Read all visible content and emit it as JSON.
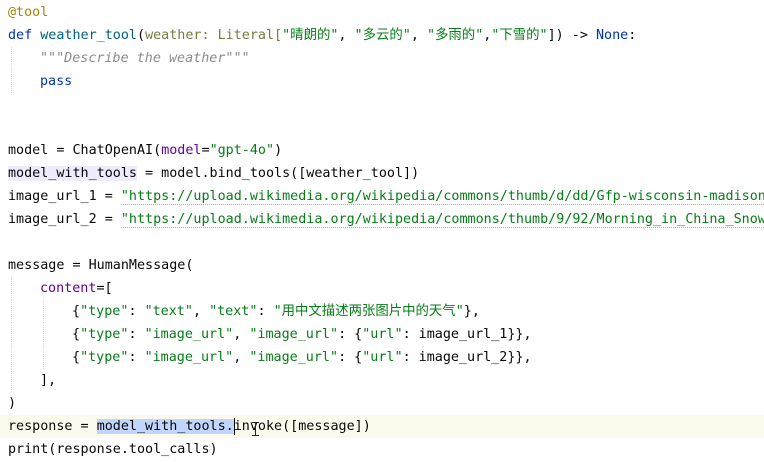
{
  "editor": {
    "lines": [
      {
        "indent": 0,
        "tokens": [
          {
            "t": "@tool",
            "c": "deco"
          }
        ]
      },
      {
        "indent": 0,
        "tokens": [
          {
            "t": "def ",
            "c": "kw"
          },
          {
            "t": "weather_tool",
            "c": "fn"
          },
          {
            "t": "(",
            "c": "plain"
          },
          {
            "t": "weather",
            "c": "param"
          },
          {
            "t": ": Literal[",
            "c": "param"
          },
          {
            "t": "\"晴朗的\"",
            "c": "str"
          },
          {
            "t": ", ",
            "c": "plain"
          },
          {
            "t": "\"多云的\"",
            "c": "str"
          },
          {
            "t": ", ",
            "c": "plain"
          },
          {
            "t": "\"多雨的\"",
            "c": "str"
          },
          {
            "t": ",",
            "c": "plain"
          },
          {
            "t": "\"下雪的\"",
            "c": "str"
          },
          {
            "t": "]) -> ",
            "c": "plain"
          },
          {
            "t": "None",
            "c": "kw"
          },
          {
            "t": ":",
            "c": "plain"
          }
        ]
      },
      {
        "indent": 1,
        "tokens": [
          {
            "t": "\"\"\"Describe the weather\"\"\"",
            "c": "doc"
          }
        ]
      },
      {
        "indent": 1,
        "tokens": [
          {
            "t": "pass",
            "c": "kw"
          }
        ]
      },
      {
        "indent": 0,
        "tokens": []
      },
      {
        "indent": 0,
        "tokens": []
      },
      {
        "indent": 0,
        "tokens": [
          {
            "t": "model = ChatOpenAI(",
            "c": "plain"
          },
          {
            "t": "model",
            "c": "kwarg"
          },
          {
            "t": "=",
            "c": "plain"
          },
          {
            "t": "\"gpt-4o\"",
            "c": "str"
          },
          {
            "t": ")",
            "c": "plain"
          }
        ]
      },
      {
        "indent": 0,
        "tokens": [
          {
            "t": "model_with_tools",
            "c": "plain usage"
          },
          {
            "t": " = model.bind_tools([weather_tool])",
            "c": "plain"
          }
        ]
      },
      {
        "indent": 0,
        "tokens": [
          {
            "t": "image_url_1 = ",
            "c": "plain"
          },
          {
            "t": "\"https://upload.wikimedia.org/wikipedia/commons/thumb/d/dd/Gfp-wisconsin-madison-th",
            "c": "str warn"
          }
        ]
      },
      {
        "indent": 0,
        "tokens": [
          {
            "t": "image_url_2 = ",
            "c": "plain"
          },
          {
            "t": "\"https://upload.wikimedia.org/wikipedia/commons/thumb/9/92/Morning_in_China_Snow_To",
            "c": "str warn"
          }
        ]
      },
      {
        "indent": 0,
        "tokens": []
      },
      {
        "indent": 0,
        "tokens": [
          {
            "t": "message = HumanMessage(",
            "c": "plain"
          }
        ]
      },
      {
        "indent": 1,
        "tokens": [
          {
            "t": "content",
            "c": "kwarg"
          },
          {
            "t": "=[",
            "c": "plain"
          }
        ]
      },
      {
        "indent": 2,
        "tokens": [
          {
            "t": "{",
            "c": "plain"
          },
          {
            "t": "\"type\"",
            "c": "str"
          },
          {
            "t": ": ",
            "c": "plain"
          },
          {
            "t": "\"text\"",
            "c": "str"
          },
          {
            "t": ", ",
            "c": "plain"
          },
          {
            "t": "\"text\"",
            "c": "str"
          },
          {
            "t": ": ",
            "c": "plain"
          },
          {
            "t": "\"用中文描述两张图片中的天气\"",
            "c": "str"
          },
          {
            "t": "},",
            "c": "plain"
          }
        ]
      },
      {
        "indent": 2,
        "tokens": [
          {
            "t": "{",
            "c": "plain"
          },
          {
            "t": "\"type\"",
            "c": "str"
          },
          {
            "t": ": ",
            "c": "plain"
          },
          {
            "t": "\"image_url\"",
            "c": "str"
          },
          {
            "t": ", ",
            "c": "plain"
          },
          {
            "t": "\"image_url\"",
            "c": "str"
          },
          {
            "t": ": {",
            "c": "plain"
          },
          {
            "t": "\"url\"",
            "c": "str"
          },
          {
            "t": ": image_url_1}},",
            "c": "plain"
          }
        ]
      },
      {
        "indent": 2,
        "tokens": [
          {
            "t": "{",
            "c": "plain"
          },
          {
            "t": "\"type\"",
            "c": "str"
          },
          {
            "t": ": ",
            "c": "plain"
          },
          {
            "t": "\"image_url\"",
            "c": "str"
          },
          {
            "t": ", ",
            "c": "plain"
          },
          {
            "t": "\"image_url\"",
            "c": "str"
          },
          {
            "t": ": {",
            "c": "plain"
          },
          {
            "t": "\"url\"",
            "c": "str"
          },
          {
            "t": ": image_url_2}},",
            "c": "plain"
          }
        ]
      },
      {
        "indent": 1,
        "tokens": [
          {
            "t": "],",
            "c": "plain"
          }
        ]
      },
      {
        "indent": 0,
        "tokens": [
          {
            "t": ")",
            "c": "plain"
          }
        ]
      },
      {
        "indent": 0,
        "caret": true,
        "tokens": [
          {
            "t": "response = ",
            "c": "plain"
          },
          {
            "t": "model_with_tools.",
            "c": "plain sel"
          },
          {
            "t": "invoke([message])",
            "c": "plain"
          }
        ]
      },
      {
        "indent": 0,
        "tokens": [
          {
            "t": "print(response.tool_calls)",
            "c": "plain"
          }
        ]
      }
    ]
  },
  "colors": {
    "background": "#ffffff",
    "keyword": "#0033b3",
    "function": "#00627a",
    "decorator": "#9e880d",
    "string": "#067d17",
    "docstring": "#8c8c8c",
    "kwarg": "#660099",
    "selection": "#c2d6fd",
    "usage_highlight": "#edebfc",
    "caret_line": "#fcfaed"
  }
}
